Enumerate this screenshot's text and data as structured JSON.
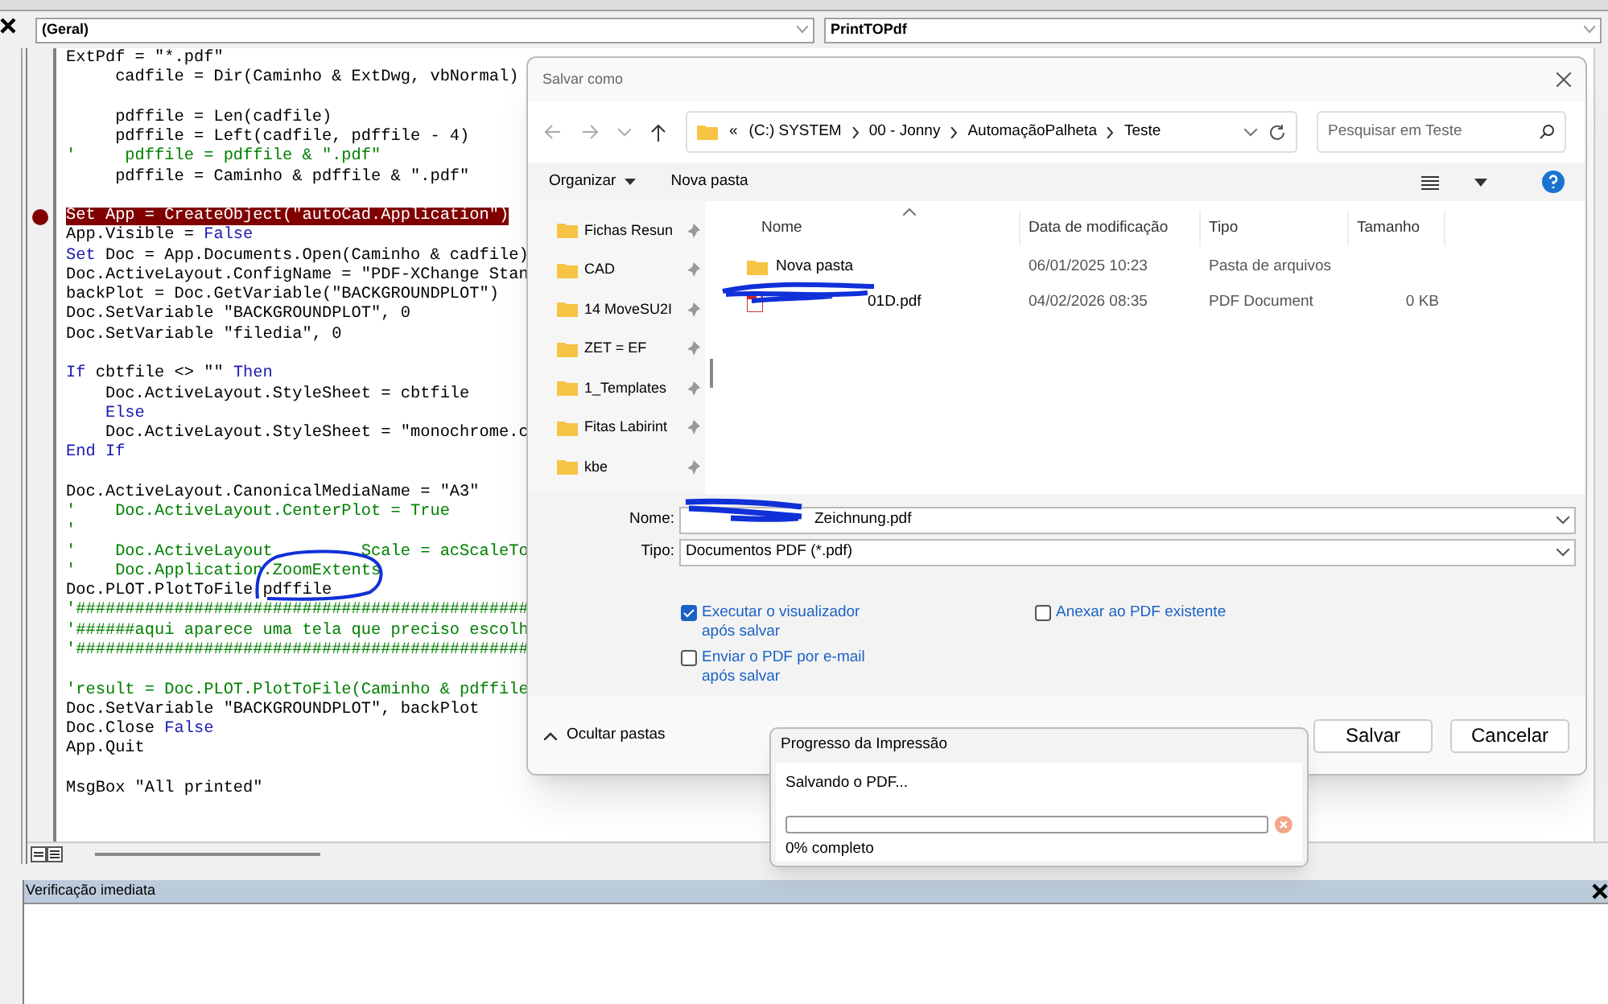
{
  "editor": {
    "object_box": "(Geral)",
    "procedure_box": "PrintTOPdf",
    "lines": [
      {
        "kind": "code",
        "parts": [
          {
            "text": "ExtPdf = \"*.pdf\""
          }
        ]
      },
      {
        "kind": "code",
        "parts": [
          {
            "text": "     cadfile = Dir(Caminho & ExtDwg, vbNormal)"
          }
        ]
      },
      {
        "kind": "blank"
      },
      {
        "kind": "code",
        "parts": [
          {
            "text": "     pdffile = Len(cadfile)"
          }
        ]
      },
      {
        "kind": "code",
        "parts": [
          {
            "text": "     pdffile = Left(cadfile, pdffile - 4)"
          }
        ]
      },
      {
        "kind": "comment",
        "parts": [
          {
            "text": "'     pdffile = pdffile & \".pdf\""
          }
        ]
      },
      {
        "kind": "code",
        "parts": [
          {
            "text": "     pdffile = Caminho & pdffile & \".pdf\""
          }
        ]
      },
      {
        "kind": "blank"
      },
      {
        "kind": "breakpoint",
        "parts": [
          {
            "text": "Set App = CreateObject(\"autoCad.Application\")"
          }
        ]
      },
      {
        "kind": "code",
        "parts": [
          {
            "text": "App.Visible = "
          },
          {
            "text": "False",
            "kind": "keyword"
          }
        ]
      },
      {
        "kind": "code",
        "parts": [
          {
            "text": "Set",
            "kind": "keyword"
          },
          {
            "text": " Doc = App.Documents.Open(Caminho & cadfile)"
          }
        ]
      },
      {
        "kind": "code",
        "parts": [
          {
            "text": "Doc.ActiveLayout.ConfigName = \"PDF-XChange Stan"
          }
        ]
      },
      {
        "kind": "code",
        "parts": [
          {
            "text": "backPlot = Doc.GetVariable(\"BACKGROUNDPLOT\")"
          }
        ]
      },
      {
        "kind": "code",
        "parts": [
          {
            "text": "Doc.SetVariable \"BACKGROUNDPLOT\", 0"
          }
        ]
      },
      {
        "kind": "code",
        "parts": [
          {
            "text": "Doc.SetVariable \"filedia\", 0"
          }
        ]
      },
      {
        "kind": "blank"
      },
      {
        "kind": "code",
        "parts": [
          {
            "text": "If",
            "kind": "keyword"
          },
          {
            "text": " cbtfile <> \"\" "
          },
          {
            "text": "Then",
            "kind": "keyword"
          }
        ]
      },
      {
        "kind": "code",
        "parts": [
          {
            "text": "    Doc.ActiveLayout.StyleSheet = cbtfile"
          }
        ]
      },
      {
        "kind": "code",
        "indented": true,
        "parts": [
          {
            "text": "Else",
            "kind": "keyword"
          }
        ]
      },
      {
        "kind": "code",
        "parts": [
          {
            "text": "    Doc.ActiveLayout.StyleSheet = \"monochrome.c"
          }
        ]
      },
      {
        "kind": "code",
        "parts": [
          {
            "text": "End If",
            "kind": "keyword"
          }
        ]
      },
      {
        "kind": "blank"
      },
      {
        "kind": "code",
        "parts": [
          {
            "text": "Doc.ActiveLayout.CanonicalMediaName = \"A3\""
          }
        ]
      },
      {
        "kind": "comment",
        "parts": [
          {
            "text": "'    Doc.ActiveLayout.CenterPlot = True"
          }
        ]
      },
      {
        "kind": "comment",
        "parts": [
          {
            "text": "'"
          }
        ]
      },
      {
        "kind": "comment",
        "parts": [
          {
            "text": "'    Doc.ActiveLayout"
          },
          {
            "text": "Scale = acScaleTo",
            "kind": "after-scribble"
          }
        ]
      },
      {
        "kind": "comment",
        "parts": [
          {
            "text": "'    Doc.Application.ZoomExtents"
          }
        ]
      },
      {
        "kind": "code",
        "parts": [
          {
            "text": "Doc.PLOT.PlotToFile pdffile"
          }
        ]
      },
      {
        "kind": "comment",
        "parts": [
          {
            "text": "'##############################################"
          }
        ]
      },
      {
        "kind": "comment",
        "parts": [
          {
            "text": "'######aqui aparece uma tela que preciso escolh"
          }
        ]
      },
      {
        "kind": "comment",
        "parts": [
          {
            "text": "'##############################################"
          }
        ]
      },
      {
        "kind": "blank"
      },
      {
        "kind": "comment",
        "parts": [
          {
            "text": "'result = Doc.PLOT.PlotToFile(Caminho & pdffile"
          }
        ]
      },
      {
        "kind": "code",
        "parts": [
          {
            "text": "Doc.SetVariable \"BACKGROUNDPLOT\", backPlot"
          }
        ]
      },
      {
        "kind": "code",
        "parts": [
          {
            "text": "Doc.Close "
          },
          {
            "text": "False",
            "kind": "keyword"
          }
        ]
      },
      {
        "kind": "code",
        "parts": [
          {
            "text": "App.Quit"
          }
        ]
      },
      {
        "kind": "blank"
      },
      {
        "kind": "code",
        "parts": [
          {
            "text": "MsgBox \"All printed\""
          }
        ]
      }
    ]
  },
  "immediate": {
    "title": "Verificação imediata"
  },
  "save_dialog": {
    "title": "Salvar como",
    "breadcrumbs": [
      {
        "text": "(C:) SYSTEM"
      },
      {
        "text": "00 - Jonny"
      },
      {
        "text": "AutomaçãoPalheta"
      },
      {
        "text": "Teste"
      }
    ],
    "overflow": "«",
    "search": {
      "placeholder": "Pesquisar em Teste"
    },
    "toolbar": [
      "Organizar",
      "Nova pasta"
    ],
    "nav_items": [
      {
        "label": "Fichas Resun"
      },
      {
        "label": "CAD"
      },
      {
        "label": "14 MoveSU2I"
      },
      {
        "label": "ZET = EF"
      },
      {
        "label": "1_Templates"
      },
      {
        "label": "Fitas Labirint"
      },
      {
        "label": "kbe"
      }
    ],
    "columns": [
      "Nome",
      "Data de modificação",
      "Tipo",
      "Tamanho"
    ],
    "rows": [
      {
        "kind": "folder",
        "name": "Nova pasta",
        "date": "06/01/2025 10:23",
        "type": "Pasta de arquivos"
      },
      {
        "kind": "pdf",
        "name": "01D.pdf",
        "date": "04/02/2026 08:35",
        "type": "PDF Document",
        "size": "0 KB"
      }
    ],
    "name_field": {
      "label": "Nome:",
      "value": "Zeichnung.pdf"
    },
    "type_field": {
      "label": "Tipo:",
      "value": "Documentos PDF (*.pdf)"
    },
    "options": [
      {
        "label": "Executar o visualizador após salvar",
        "checked": true
      },
      {
        "label": "Enviar o PDF por e-mail após salvar",
        "checked": false
      },
      {
        "label": "Anexar ao PDF existente",
        "checked": false
      }
    ],
    "hide_folders": "Ocultar pastas",
    "buttons": [
      "Salvar",
      "Cancelar"
    ]
  },
  "progress_dialog": {
    "title": "Progresso da Impressão",
    "message": "Salvando o PDF...",
    "level": 0,
    "reading": "0% completo"
  }
}
